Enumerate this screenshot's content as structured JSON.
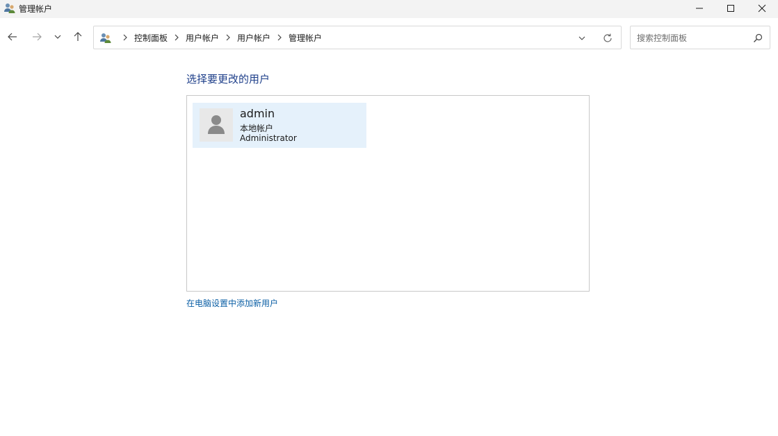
{
  "window": {
    "title": "管理帐户",
    "icon": "user-accounts-icon",
    "controls": [
      "minimize-icon",
      "maximize-icon",
      "close-icon"
    ]
  },
  "navigation": {
    "buttons": [
      "back-arrow-icon",
      "forward-arrow-icon",
      "recent-locations-chevron-icon",
      "up-arrow-icon"
    ],
    "breadcrumbs": [
      "控制面板",
      "用户帐户",
      "用户帐户",
      "管理帐户"
    ]
  },
  "search": {
    "placeholder": "搜索控制面板",
    "value": ""
  },
  "main": {
    "heading": "选择要更改的用户",
    "users": [
      {
        "name": "admin",
        "type": "本地帐户",
        "role": "Administrator",
        "avatar": "default-user-avatar-icon"
      }
    ],
    "add_user_link": "在电脑设置中添加新用户"
  },
  "colors": {
    "titlebar_bg": "#f3f3f3",
    "heading": "#1e3f8a",
    "link": "#0b5fa5",
    "selected_tile": "#e5f1fb",
    "border": "#c8c8c8"
  }
}
